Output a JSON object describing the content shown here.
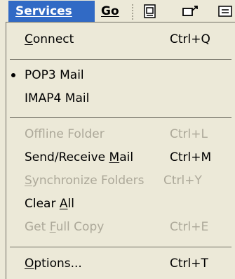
{
  "menubar": {
    "services": "Services",
    "go": "Go",
    "toolbar_icons": [
      "document-icon",
      "send-receive-icon",
      "folder-icon"
    ]
  },
  "menu": {
    "connect": {
      "label": "Connect",
      "shortcut": "Ctrl+Q"
    },
    "pop3": {
      "label": "POP3 Mail",
      "selected": true
    },
    "imap4": {
      "label": "IMAP4 Mail"
    },
    "offline": {
      "label": "Offline Folder",
      "shortcut": "Ctrl+L",
      "enabled": false
    },
    "send_receive": {
      "label_pre": "Send/Receive ",
      "label_key": "M",
      "label_post": "ail",
      "shortcut": "Ctrl+M"
    },
    "synchronize": {
      "label": "Synchronize Folders",
      "shortcut": "Ctrl+Y",
      "enabled": false
    },
    "clear_all": {
      "label_pre": "Clear ",
      "label_key": "A",
      "label_post": "ll"
    },
    "get_full_copy": {
      "label_pre": "Get ",
      "label_key": "F",
      "label_post": "ull Copy",
      "shortcut": "Ctrl+E",
      "enabled": false
    },
    "options": {
      "label_key": "O",
      "label_post": "ptions...",
      "shortcut": "Ctrl+T"
    }
  }
}
